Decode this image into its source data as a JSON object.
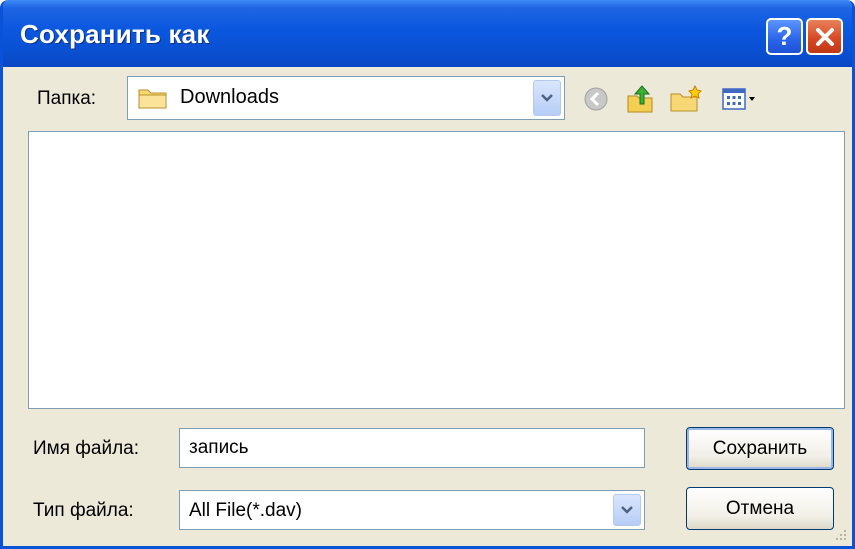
{
  "window": {
    "title": "Сохранить как"
  },
  "titlebar": {
    "help_label": "?"
  },
  "folder": {
    "label": "Папка:",
    "value": "Downloads",
    "icon": "folder-icon"
  },
  "toolbar": {
    "icons": [
      "back-icon",
      "up-folder-icon",
      "new-folder-icon",
      "view-menu-icon"
    ]
  },
  "filename": {
    "label": "Имя файла:",
    "value": "запись"
  },
  "filetype": {
    "label": "Тип файла:",
    "value": "All File(*.dav)"
  },
  "buttons": {
    "save": "Сохранить",
    "cancel": "Отмена"
  },
  "colors": {
    "titlebar": "#0a57de",
    "dialog_bg": "#ece9d8",
    "close": "#d84a26"
  }
}
